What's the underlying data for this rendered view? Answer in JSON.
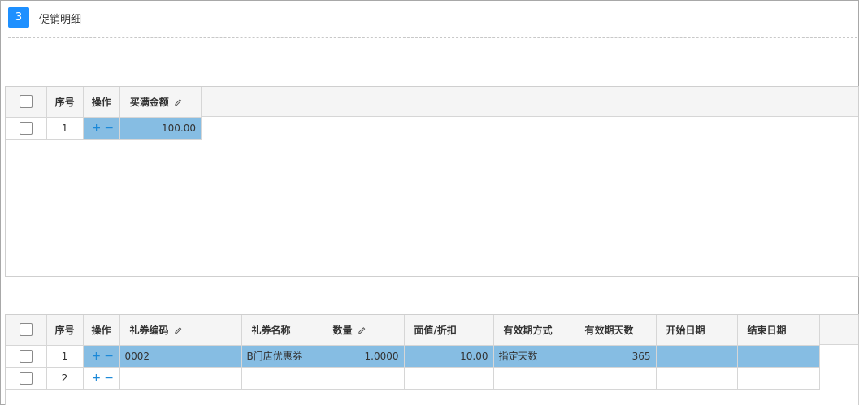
{
  "section": {
    "step": "3",
    "title": "促销明细"
  },
  "grid1": {
    "headers": {
      "checkbox": "",
      "seq": "序号",
      "op": "操作",
      "amount": "买满金额"
    },
    "rows": [
      {
        "seq": "1",
        "plus": "+",
        "minus": "−",
        "amount": "100.00"
      }
    ]
  },
  "grid2": {
    "headers": {
      "seq": "序号",
      "op": "操作",
      "code": "礼券编码",
      "name": "礼券名称",
      "qty": "数量",
      "value": "面值/折扣",
      "validity_mode": "有效期方式",
      "validity_days": "有效期天数",
      "start": "开始日期",
      "end": "结束日期"
    },
    "rows": [
      {
        "seq": "1",
        "plus": "+",
        "minus": "−",
        "code": "0002",
        "name": "B门店优惠券",
        "qty": "1.0000",
        "value": "10.00",
        "validity_mode": "指定天数",
        "validity_days": "365",
        "start": "",
        "end": ""
      },
      {
        "seq": "2",
        "plus": "+",
        "minus": "−",
        "code": "",
        "name": "",
        "qty": "",
        "value": "",
        "validity_mode": "",
        "validity_days": "",
        "start": "",
        "end": ""
      }
    ]
  },
  "colors": {
    "accent": "#1e90ff",
    "selected_row": "#86bde3",
    "op_icon": "#1a88d8"
  }
}
